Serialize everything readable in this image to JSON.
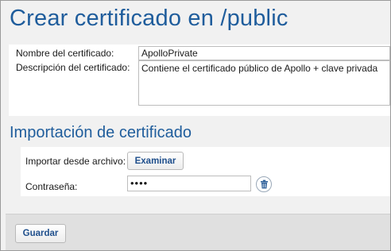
{
  "page": {
    "title": "Crear certificado en /public"
  },
  "certificate": {
    "name_label": "Nombre del certificado:",
    "name_value": "ApolloPrivate",
    "description_label": "Descripción del certificado:",
    "description_value": "Contiene el certificado público de Apollo + clave privada"
  },
  "import": {
    "section_title": "Importación de certificado",
    "file_label": "Importar desde archivo:",
    "browse_label": "Examinar",
    "password_label": "Contraseña:",
    "password_value": "••••",
    "delete_icon": "trash-icon"
  },
  "footer": {
    "save_label": "Guardar"
  }
}
